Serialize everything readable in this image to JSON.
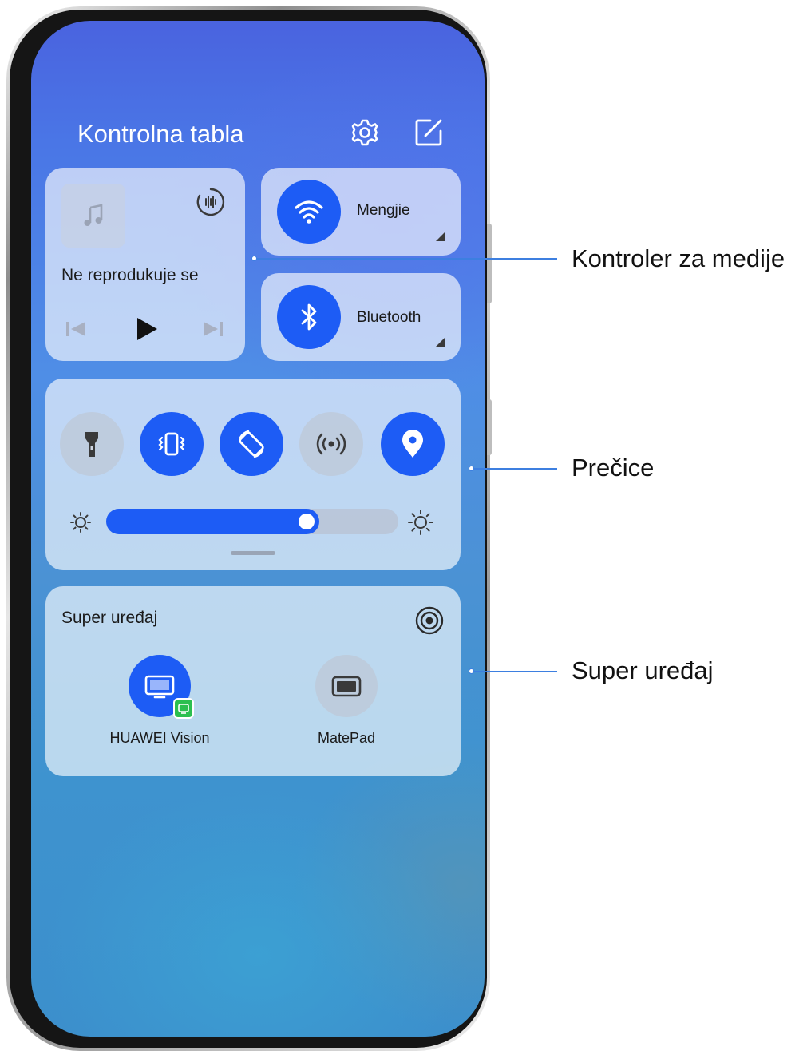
{
  "control_panel": {
    "title": "Kontrolna tabla",
    "settings_icon": "gear-icon",
    "edit_icon": "edit-icon"
  },
  "media": {
    "status": "Ne reprodukuje se",
    "art_icon": "music-note-icon",
    "output_icon": "audio-output-icon",
    "controls": [
      "previous-icon",
      "play-icon",
      "next-icon"
    ]
  },
  "wifi": {
    "label": "Mengjie",
    "icon": "wifi-icon",
    "active": true
  },
  "bluetooth": {
    "label": "Bluetooth",
    "icon": "bluetooth-icon",
    "active": true
  },
  "shortcuts": [
    {
      "icon": "flashlight-icon",
      "active": false
    },
    {
      "icon": "vibrate-icon",
      "active": true
    },
    {
      "icon": "auto-rotate-icon",
      "active": true
    },
    {
      "icon": "hotspot-icon",
      "active": false
    },
    {
      "icon": "location-icon",
      "active": true
    }
  ],
  "brightness": {
    "level": 0.73,
    "low_icon": "brightness-low-icon",
    "high_icon": "brightness-high-icon"
  },
  "super_device": {
    "title": "Super uređaj",
    "devices": [
      {
        "label": "HUAWEI Vision",
        "icon": "tv-icon",
        "connected": true,
        "badge_icon": "projection-badge-icon"
      },
      {
        "label": "MatePad",
        "icon": "tablet-icon",
        "connected": false
      }
    ]
  },
  "callouts": {
    "media": "Kontroler za medije",
    "shortcuts": "Prečice",
    "super_device": "Super uređaj"
  },
  "colors": {
    "accent": "#1d5cf5",
    "callout_line": "#3d7fe0"
  }
}
